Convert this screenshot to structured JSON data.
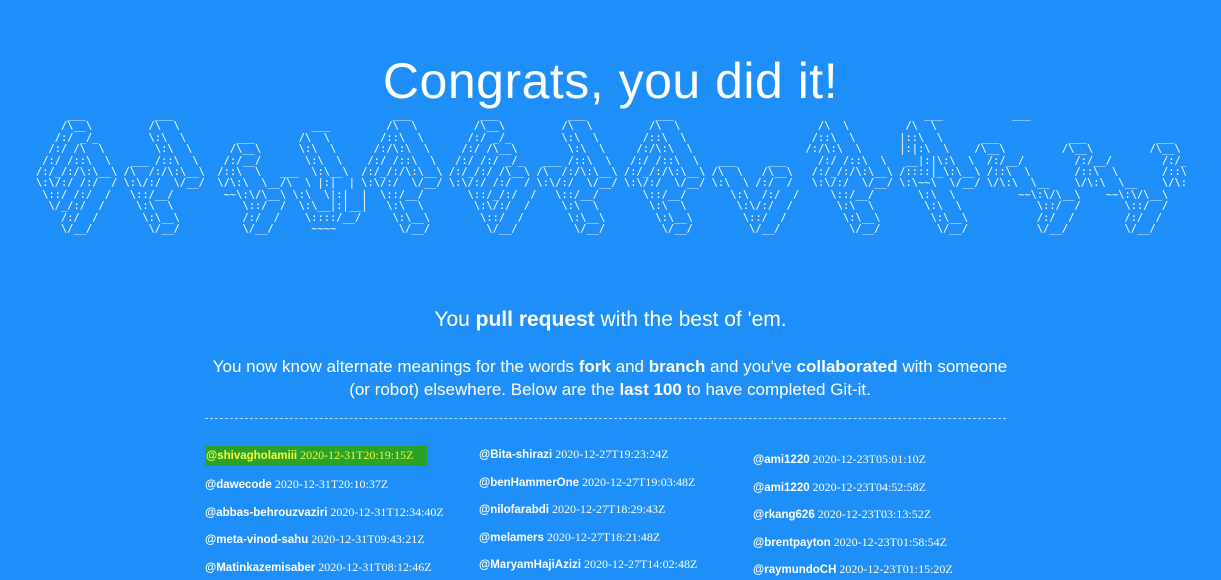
{
  "headline": "Congrats, you did it!",
  "ascii_art": "     ___           ___                                   ___           ___           ___           ___                                        ___           ___\n    /\\__\\         /\\  \\                     ___         /\\  \\         /\\__\\         /\\  \\         /\\  \\                      /\\  \\         /\\  \\\n   /:/ _/_        \\:\\  \\        ___       /\\  \\        /::\\  \\       /:/ _/_        \\:\\  \\       /::\\  \\                    /::\\  \\       |::\\  \\      ___           ___           ___\n  /:/ /\\  \\        \\:\\  \\      /\\__\\      \\:\\  \\      /:/\\:\\  \\     /:/ /\\__\\        \\:\\  \\     /:/\\:\\  \\                  /:/\\:\\  \\      |:|:\\  \\    /\\__\\         /\\__\\         /\\__\\\n /:/ /::\\  \\   ___ /::\\  \\    /:/__/       \\:\\  \\    /:/ /::\\  \\   /:/ /:/ _/_   ___ /::\\  \\   /:/ /::\\  \\   ___     ___     /:/ /::\\  \\   __|:|\\:\\  \\  /:/__/        /:/__/        /:/__/\n/:/_/:/\\:\\__\\ /\\  /:/\\:\\__\\  /::\\  \\   ___  \\:\\__\\  /:/_/:/\\:\\__\\ /:/_/:/ /\\__\\ /\\  /:/\\:\\__\\ /:/_/:/\\:\\__\\ /\\  \\   /\\__\\   /:/_/:/\\:\\__\\ /::::|_\\:\\__\\ /::\\  \\       /::\\  \\       /::\\  \\\n\\:\\/:/ /:/  / \\:\\/:/  \\/__/  \\/\\:\\  \\__/\\  \\ |:|  | \\:\\/:/  \\/__/ \\:\\/:/ /:/  / \\:\\/:/  \\/__/ \\:\\/:/  \\/__/ \\:\\  \\ /:/  /   \\:\\/:/  \\/__/ \\:\\~~\\  \\/__/ \\/\\:\\  \\__    \\/\\:\\  \\__    \\/\\:\\  \\__\n \\::/ /:/  /   \\::/__/        ~~\\:\\/\\__\\ \\:\\  \\|:|  |  \\::/__/       \\::/_/:/  /   \\::/__/       \\::/__/       \\:\\  /:/  /     \\::/__/       \\:\\  \\          ~~\\:\\/\\__\\    ~~\\:\\/\\__\\    ~~\\:\\/\\__\\\n  \\/_/:/  /     \\:\\  \\           \\::/  /  \\:\\__|:|__|   \\:\\  \\        \\:\\/:/  /     \\:\\  \\        \\:\\  \\        \\:\\/:/  /       \\:\\  \\        \\:\\  \\            \\::/  /       \\::/  /       \\::/  /\n    /:/  /       \\:\\__\\          /:/  /    \\::::/__/     \\:\\__\\        \\::/  /       \\:\\__\\        \\:\\__\\        \\::/  /         \\:\\__\\        \\:\\__\\           /:/  /        /:/  /        /:/  /\n    \\/__/         \\/__/          \\/__/      ~~~~          \\/__/         \\/__/         \\/__/         \\/__/         \\/__/           \\/__/         \\/__/           \\/__/         \\/__/         \\/__/",
  "tagline": {
    "pre": "You ",
    "bold": "pull request",
    "post": " with the best of 'em."
  },
  "description": {
    "t1": "You now know alternate meanings for the words ",
    "b1": "fork",
    "t2": " and ",
    "b2": "branch",
    "t3": " and you've ",
    "b3": "collaborated",
    "t4": " with someone (or robot) elsewhere. Below are the ",
    "b4": "last 100",
    "t5": " to have completed Git-it."
  },
  "completions": {
    "column_1": [
      {
        "user": "@shivagholamiii",
        "time": "2020-12-31T20:19:15Z"
      },
      {
        "user": "@dawecode",
        "time": "2020-12-31T20:10:37Z"
      },
      {
        "user": "@abbas-behrouzvaziri",
        "time": "2020-12-31T12:34:40Z"
      },
      {
        "user": "@meta-vinod-sahu",
        "time": "2020-12-31T09:43:21Z"
      },
      {
        "user": "@Matinkazemisaber",
        "time": "2020-12-31T08:12:46Z"
      }
    ],
    "column_2": [
      {
        "user": "@Bita-shirazi",
        "time": "2020-12-27T19:23:24Z"
      },
      {
        "user": "@benHammerOne",
        "time": "2020-12-27T19:03:48Z"
      },
      {
        "user": "@nilofarabdi",
        "time": "2020-12-27T18:29:43Z"
      },
      {
        "user": "@melamers",
        "time": "2020-12-27T18:21:48Z"
      },
      {
        "user": "@MaryamHajiAzizi",
        "time": "2020-12-27T14:02:48Z"
      }
    ],
    "column_3": [
      {
        "user": "@ami1220",
        "time": "2020-12-23T05:01:10Z"
      },
      {
        "user": "@ami1220",
        "time": "2020-12-23T04:52:58Z"
      },
      {
        "user": "@rkang626",
        "time": "2020-12-23T03:13:52Z"
      },
      {
        "user": "@brentpayton",
        "time": "2020-12-23T01:58:54Z"
      },
      {
        "user": "@raymundoCH",
        "time": "2020-12-23T01:15:20Z"
      }
    ]
  },
  "colors": {
    "background": "#1e8ff9",
    "highlight_background": "#2aa22a",
    "highlight_text": "#f4ff3a"
  }
}
